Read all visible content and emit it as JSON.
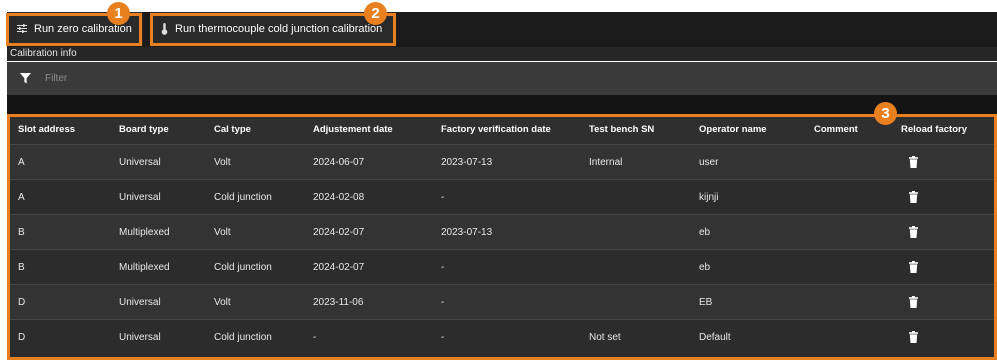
{
  "toolbar": {
    "zero_label": "Run zero calibration",
    "tc_label": "Run thermocouple cold junction calibration"
  },
  "badges": [
    "1",
    "2",
    "3"
  ],
  "section_title": "Calibration info",
  "filter": {
    "label": "Filter",
    "icon": "filter-icon"
  },
  "colors": {
    "accent": "#e8801f",
    "background": "#2b2b2b",
    "text": "#e8e8e8"
  },
  "table": {
    "headers": [
      "Slot address",
      "Board type",
      "Cal type",
      "Adjustement date",
      "Factory verification date",
      "Test bench SN",
      "Operator name",
      "Comment",
      "Reload factory"
    ],
    "rows": [
      [
        "A",
        "Universal",
        "Volt",
        "2024-06-07",
        "2023-07-13",
        "Internal",
        "user",
        ""
      ],
      [
        "A",
        "Universal",
        "Cold junction",
        "2024-02-08",
        "-",
        "",
        "kijnji",
        ""
      ],
      [
        "B",
        "Multiplexed",
        "Volt",
        "2024-02-07",
        "2023-07-13",
        "",
        "eb",
        ""
      ],
      [
        "B",
        "Multiplexed",
        "Cold junction",
        "2024-02-07",
        "-",
        "",
        "eb",
        ""
      ],
      [
        "D",
        "Universal",
        "Volt",
        "2023-11-06",
        "-",
        "",
        "EB",
        ""
      ],
      [
        "D",
        "Universal",
        "Cold junction",
        "-",
        "-",
        "Not set",
        "Default",
        ""
      ]
    ],
    "row_action_icon": "trash-icon"
  }
}
